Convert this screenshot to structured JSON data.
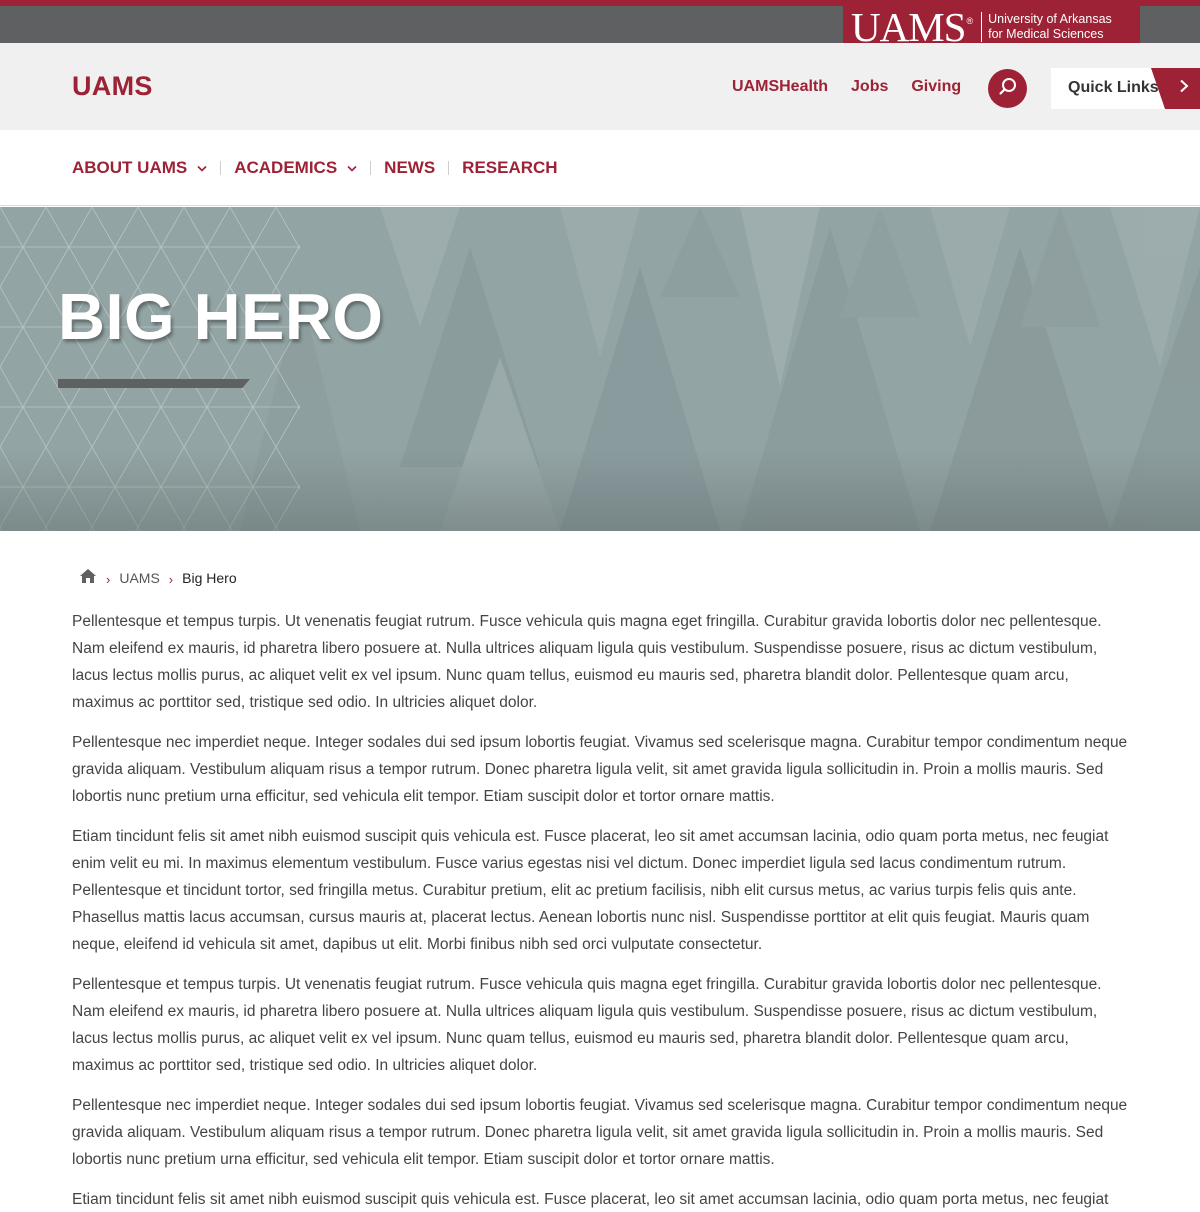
{
  "brand": {
    "wordmark": "UAMS",
    "registered": "®",
    "line1": "University of Arkansas",
    "line2": "for Medical Sciences"
  },
  "header": {
    "logo": "UAMS",
    "links": [
      "UAMSHealth",
      "Jobs",
      "Giving"
    ],
    "quick_links_label": "Quick Links",
    "search_icon": "search-icon"
  },
  "nav": {
    "items": [
      {
        "label": "ABOUT UAMS",
        "has_dropdown": true
      },
      {
        "label": "ACADEMICS",
        "has_dropdown": true
      },
      {
        "label": "NEWS",
        "has_dropdown": false
      },
      {
        "label": "RESEARCH",
        "has_dropdown": false
      }
    ]
  },
  "hero": {
    "title": "BIG HERO"
  },
  "breadcrumb": {
    "home_icon": "home-icon",
    "separator": "›",
    "items": [
      "UAMS",
      "Big Hero"
    ]
  },
  "content": {
    "paragraphs": [
      "Pellentesque et tempus turpis. Ut venenatis feugiat rutrum. Fusce vehicula quis magna eget fringilla. Curabitur gravida lobortis dolor nec pellentesque. Nam eleifend ex mauris, id pharetra libero posuere at. Nulla ultrices aliquam ligula quis vestibulum. Suspendisse posuere, risus ac dictum vestibulum, lacus lectus mollis purus, ac aliquet velit ex vel ipsum. Nunc quam tellus, euismod eu mauris sed, pharetra blandit dolor. Pellentesque quam arcu, maximus ac porttitor sed, tristique sed odio. In ultricies aliquet dolor.",
      "Pellentesque nec imperdiet neque. Integer sodales dui sed ipsum lobortis feugiat. Vivamus sed scelerisque magna. Curabitur tempor condimentum neque gravida aliquam. Vestibulum aliquam risus a tempor rutrum. Donec pharetra ligula velit, sit amet gravida ligula sollicitudin in. Proin a mollis mauris. Sed lobortis nunc pretium urna efficitur, sed vehicula elit tempor. Etiam suscipit dolor et tortor ornare mattis.",
      "Etiam tincidunt felis sit amet nibh euismod suscipit quis vehicula est. Fusce placerat, leo sit amet accumsan lacinia, odio quam porta metus, nec feugiat enim velit eu mi. In maximus elementum vestibulum. Fusce varius egestas nisi vel dictum. Donec imperdiet ligula sed lacus condimentum rutrum. Pellentesque et tincidunt tortor, sed fringilla metus. Curabitur pretium, elit ac pretium facilisis, nibh elit cursus metus, ac varius turpis felis quis ante. Phasellus mattis lacus accumsan, cursus mauris at, placerat lectus. Aenean lobortis nunc nisl. Suspendisse porttitor at elit quis feugiat. Mauris quam neque, eleifend id vehicula sit amet, dapibus ut elit. Morbi finibus nibh sed orci vulputate consectetur.",
      "Pellentesque et tempus turpis. Ut venenatis feugiat rutrum. Fusce vehicula quis magna eget fringilla. Curabitur gravida lobortis dolor nec pellentesque. Nam eleifend ex mauris, id pharetra libero posuere at. Nulla ultrices aliquam ligula quis vestibulum. Suspendisse posuere, risus ac dictum vestibulum, lacus lectus mollis purus, ac aliquet velit ex vel ipsum. Nunc quam tellus, euismod eu mauris sed, pharetra blandit dolor. Pellentesque quam arcu, maximus ac porttitor sed, tristique sed odio. In ultricies aliquet dolor.",
      "Pellentesque nec imperdiet neque. Integer sodales dui sed ipsum lobortis feugiat. Vivamus sed scelerisque magna. Curabitur tempor condimentum neque gravida aliquam. Vestibulum aliquam risus a tempor rutrum. Donec pharetra ligula velit, sit amet gravida ligula sollicitudin in. Proin a mollis mauris. Sed lobortis nunc pretium urna efficitur, sed vehicula elit tempor. Etiam suscipit dolor et tortor ornare mattis.",
      "Etiam tincidunt felis sit amet nibh euismod suscipit quis vehicula est. Fusce placerat, leo sit amet accumsan lacinia, odio quam porta metus, nec feugiat enim"
    ]
  },
  "colors": {
    "brand_red": "#9d2235",
    "gray_bar": "#5f6062",
    "header_bg": "#f0f0f0",
    "hero_bg": "#8e9f9f"
  }
}
